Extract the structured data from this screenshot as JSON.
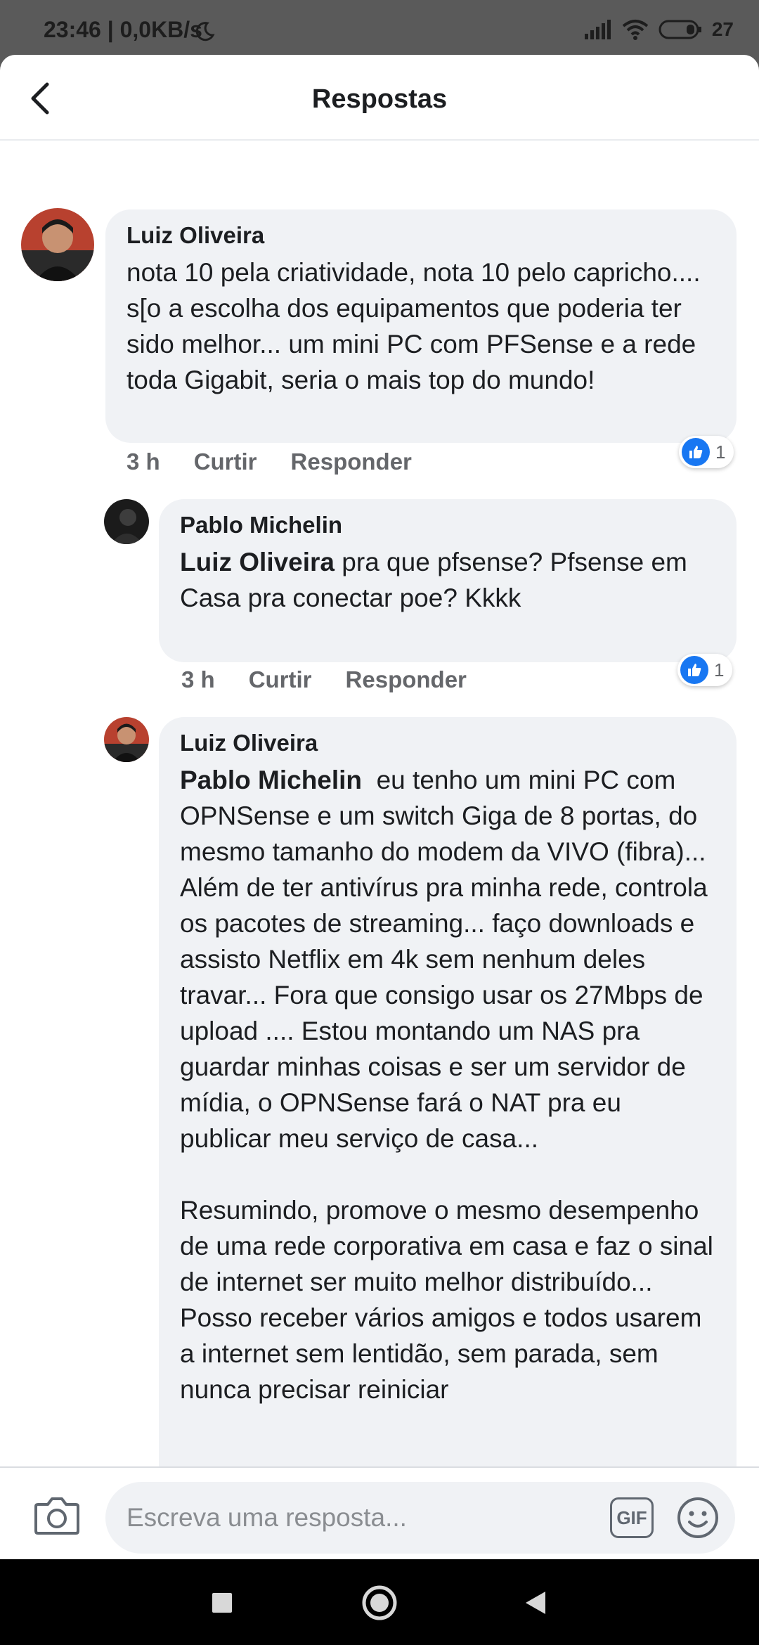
{
  "status_bar": {
    "time": "23:46 | 0,0KB/s",
    "battery": "27"
  },
  "header": {
    "title": "Respostas"
  },
  "comments": [
    {
      "author": "Luiz Oliveira",
      "mention": "",
      "text": "nota 10 pela criatividade, nota 10 pelo capricho....  s[o a escolha dos equipamentos que poderia ter sido melhor... um mini PC com PFSense e a rede toda Gigabit, seria o mais top do mundo!",
      "time": "3 h",
      "like_label": "Curtir",
      "reply_label": "Responder",
      "reactions": "1"
    },
    {
      "author": "Pablo Michelin",
      "mention": "Luiz Oliveira",
      "text": " pra que pfsense? Pfsense em\nCasa pra conectar poe? Kkkk",
      "time": "3 h",
      "like_label": "Curtir",
      "reply_label": "Responder",
      "reactions": "1"
    },
    {
      "author": "Luiz Oliveira",
      "mention": "Pablo Michelin",
      "text": "  eu tenho um mini PC com OPNSense e um switch Giga de 8 portas, do mesmo tamanho do modem da VIVO (fibra)... Além de ter antivírus pra minha rede, controla os pacotes de streaming... faço downloads e assisto Netflix em 4k sem nenhum deles travar... Fora que consigo usar os 27Mbps de upload .... Estou montando um NAS pra guardar minhas coisas e ser um servidor de mídia, o OPNSense fará o NAT pra eu publicar meu serviço de casa...\n\nResumindo, promove o mesmo desempenho de uma rede corporativa em casa e faz o sinal de internet ser muito melhor distribuído... Posso receber vários amigos e todos usarem a internet sem lentidão, sem parada, sem nunca precisar reiniciar"
    }
  ],
  "composer": {
    "placeholder": "Escreva uma resposta...",
    "gif_label": "GIF"
  },
  "colors": {
    "accent": "#1877f2",
    "bubble": "#f0f2f5",
    "secondary_text": "#65676b"
  }
}
